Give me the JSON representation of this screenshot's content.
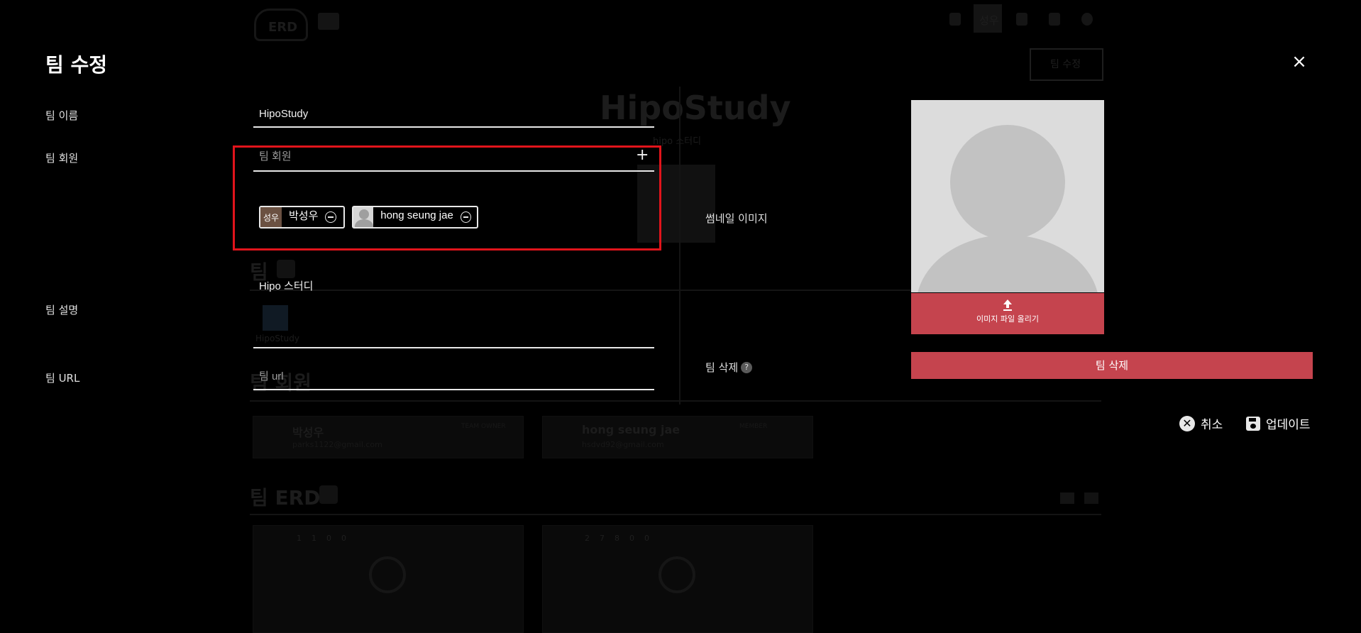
{
  "modal": {
    "title": "팀 수정",
    "close_icon": "×"
  },
  "fields": {
    "name_label": "팀 이름",
    "name_value": "HipoStudy",
    "members_label": "팀 회원",
    "members_placeholder": "팀 회원",
    "add_member_icon": "+",
    "description_label": "팀 설명",
    "description_value": "Hipo 스터디",
    "url_label": "팀 URL",
    "url_placeholder": "팀 url"
  },
  "members": [
    {
      "avatar_text": "성우",
      "name": "박성우"
    },
    {
      "avatar_text": "",
      "name": "hong seung jae"
    }
  ],
  "thumbnail": {
    "label": "썸네일 이미지",
    "upload_label": "이미지 파일 올리기"
  },
  "delete": {
    "label": "팀 삭제",
    "help_icon": "?",
    "button_label": "팀 삭제"
  },
  "actions": {
    "cancel_icon": "✕",
    "cancel_label": "취소",
    "update_label": "업데이트"
  },
  "background": {
    "logo_text": "ERD",
    "avatar_text": "성우",
    "edit_button": "팀 수정",
    "team_title": "HipoStudy",
    "team_subtitle": "hipo 스터디",
    "section_team": "팀",
    "team_card_label": "HipoStudy",
    "section_members": "팀 회원",
    "member1_name": "박성우",
    "member1_email": "parks1122@gmail.com",
    "member1_role": "TEAM OWNER",
    "member2_name": "hong seung jae",
    "member2_email": "hsdvd92@gmail.com",
    "member2_role": "MEMBER",
    "section_erd": "팀 ERD",
    "erd1_stats": [
      "1",
      "1",
      "0",
      "0"
    ],
    "erd2_stats": [
      "27",
      "8",
      "0",
      "0"
    ]
  },
  "colors": {
    "accent_red": "#c5444e",
    "highlight_red": "#e1141b",
    "background": "#000000"
  }
}
